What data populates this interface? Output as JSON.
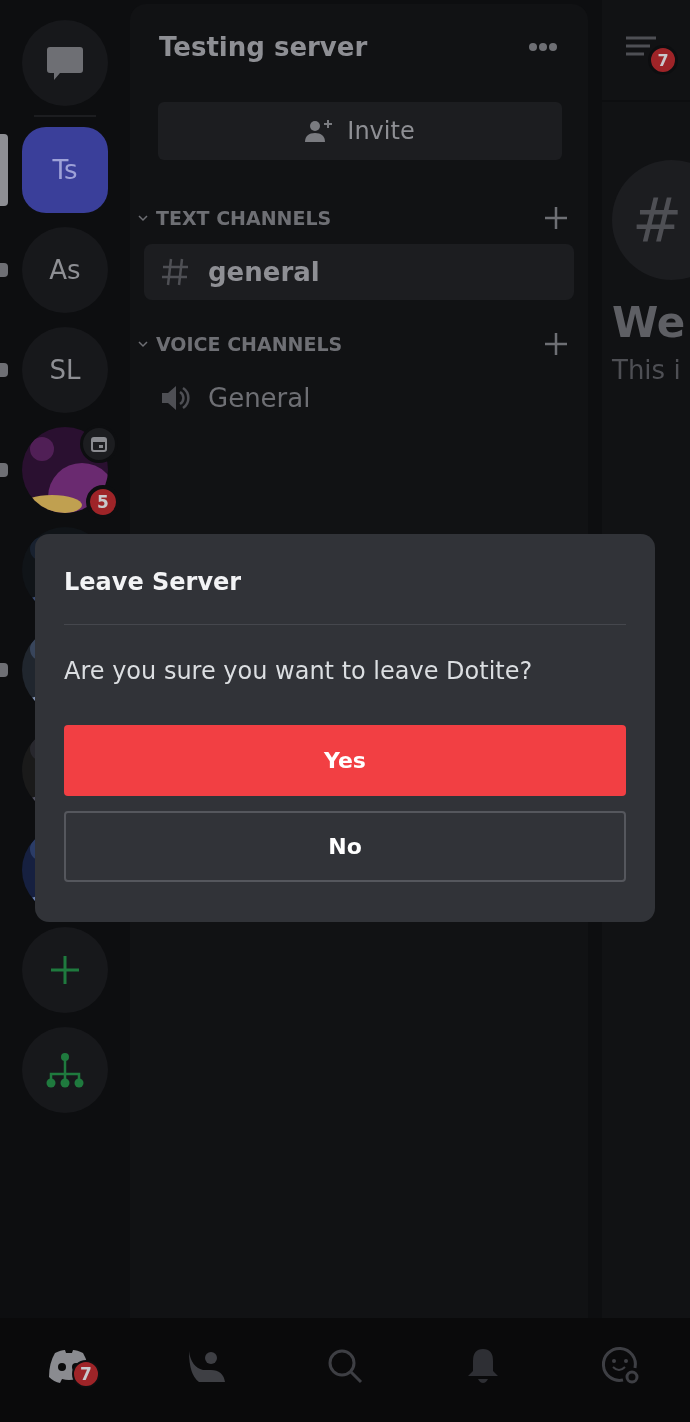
{
  "servers": [
    {
      "kind": "dm"
    },
    {
      "kind": "separator"
    },
    {
      "kind": "text",
      "label": "Ts",
      "selected": true
    },
    {
      "kind": "text",
      "label": "As",
      "selected": false,
      "unread": true
    },
    {
      "kind": "text",
      "label": "SL",
      "selected": false,
      "unread": true
    },
    {
      "kind": "picture",
      "selected": false,
      "unread": true,
      "event": true,
      "badge": "5"
    },
    {
      "kind": "picture",
      "selected": false,
      "unread": false
    },
    {
      "kind": "picture",
      "selected": false,
      "unread": true
    },
    {
      "kind": "picture",
      "selected": false,
      "unread": false
    },
    {
      "kind": "picture",
      "selected": false,
      "unread": false
    },
    {
      "kind": "add"
    },
    {
      "kind": "discover"
    }
  ],
  "server": {
    "title": "Testing server",
    "invite": "Invite",
    "categories": [
      {
        "name": "TEXT CHANNELS",
        "expanded": true,
        "channels": [
          {
            "kind": "text",
            "name": "general",
            "selected": true
          }
        ]
      },
      {
        "name": "VOICE CHANNELS",
        "expanded": true,
        "channels": [
          {
            "kind": "voice",
            "name": "General",
            "selected": false
          }
        ]
      }
    ]
  },
  "chat": {
    "badge": "7",
    "hash": "#",
    "heading": "We",
    "subtitle": "This i"
  },
  "dialog": {
    "title": "Leave Server",
    "message": "Are you sure you want to leave Dotite?",
    "buttons": [
      {
        "kind": "danger",
        "label": "Yes"
      },
      {
        "kind": "outline",
        "label": "No"
      }
    ]
  },
  "nav": [
    {
      "kind": "home",
      "selected": true,
      "badge": "7"
    },
    {
      "kind": "friends",
      "selected": false
    },
    {
      "kind": "search",
      "selected": false
    },
    {
      "kind": "bell",
      "selected": false
    },
    {
      "kind": "profile",
      "selected": false
    }
  ]
}
